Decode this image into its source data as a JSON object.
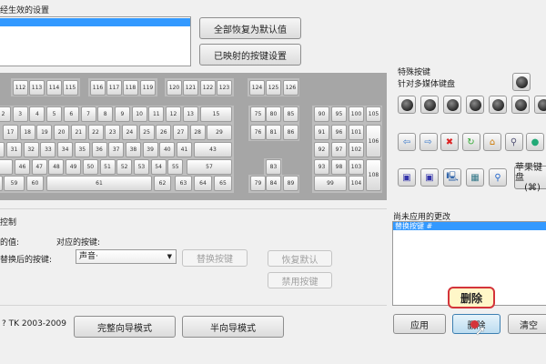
{
  "top": {
    "label": "经生效的设置",
    "restore_all": "全部恢复为默认值",
    "mapped": "已映射的按键设置"
  },
  "keyboard": {
    "fn": [
      "112",
      "113",
      "114",
      "115",
      "116",
      "117",
      "118",
      "119",
      "120",
      "121",
      "122",
      "123",
      "124",
      "125",
      "126"
    ],
    "row1": [
      "2",
      "3",
      "4",
      "5",
      "6",
      "7",
      "8",
      "9",
      "10",
      "11",
      "12",
      "13",
      "15"
    ],
    "row2": [
      "17",
      "18",
      "19",
      "20",
      "21",
      "22",
      "23",
      "24",
      "25",
      "26",
      "27",
      "28",
      "29"
    ],
    "row3": [
      "31",
      "32",
      "33",
      "34",
      "35",
      "36",
      "37",
      "38",
      "39",
      "40",
      "41",
      "43"
    ],
    "row4": [
      "46",
      "47",
      "48",
      "49",
      "50",
      "51",
      "52",
      "53",
      "54",
      "55",
      "57"
    ],
    "row5": [
      "59",
      "60",
      "61",
      "62",
      "63",
      "64",
      "65"
    ],
    "nav": [
      "75",
      "80",
      "85",
      "76",
      "81",
      "86",
      "83",
      "79",
      "84",
      "89"
    ],
    "num": [
      "90",
      "95",
      "100",
      "105",
      "91",
      "96",
      "101",
      "106",
      "92",
      "97",
      "102",
      "93",
      "98",
      "103",
      "108",
      "99",
      "104"
    ]
  },
  "special": {
    "title": "特殊按键",
    "subtitle": "针对多媒体键盘",
    "apple": "苹果键盘",
    "apple_sym": "(⌘)"
  },
  "control": {
    "title": "控制",
    "value_label": "的值:",
    "mapped_key_label": "对应的按键:",
    "replace_label": "替换后的按键:",
    "dropdown_value": "声音·",
    "replace_btn": "替换按键",
    "restore_btn": "恢复默认",
    "disable_btn": "禁用按键"
  },
  "footer": {
    "copyright": "? TK 2003-2009",
    "full_wizard": "完整向导模式",
    "half_wizard": "半向导模式"
  },
  "pending": {
    "label": "尚未应用的更改",
    "items": [
      "替换按键 #"
    ],
    "apply": "应用",
    "delete": "删除",
    "clear": "清空",
    "tooltip": "删除"
  }
}
